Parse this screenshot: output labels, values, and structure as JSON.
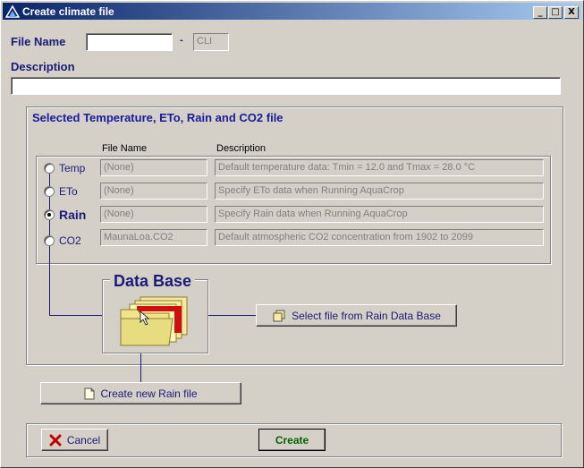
{
  "window": {
    "title": "Create climate file",
    "controls": [
      "_",
      "□",
      "X"
    ]
  },
  "file_name": {
    "label": "File Name",
    "value": "",
    "dot": "-",
    "extension": "CLI"
  },
  "description": {
    "label": "Description",
    "value": ""
  },
  "selection_group": {
    "title": "Selected Temperature, ETo, Rain and CO2 file",
    "column_file_name": "File Name",
    "column_description": "Description",
    "rows": [
      {
        "label": "Temp",
        "file": "(None)",
        "description": "Default temperature data: Tmin = 12.0 and Tmax = 28.0 °C",
        "checked": false
      },
      {
        "label": "ETo",
        "file": "(None)",
        "description": "Specify ETo data when Running AquaCrop",
        "checked": false
      },
      {
        "label": "Rain",
        "file": "(None)",
        "description": "Specify Rain data when Running AquaCrop",
        "checked": true
      },
      {
        "label": "CO2",
        "file": "MaunaLoa.CO2",
        "description": "Default atmospheric CO2 concentration from 1902 to 2099",
        "checked": false
      }
    ]
  },
  "database": {
    "title": "Data Base",
    "select_button": "Select file from Rain Data Base",
    "create_button": "Create new Rain file"
  },
  "footer": {
    "cancel_label": "Cancel",
    "create_label": "Create"
  },
  "colors": {
    "title_gradient_start": "#0a246a",
    "label_blue": "#1a1a78",
    "create_green": "#006400",
    "cancel_red": "#c00000"
  }
}
